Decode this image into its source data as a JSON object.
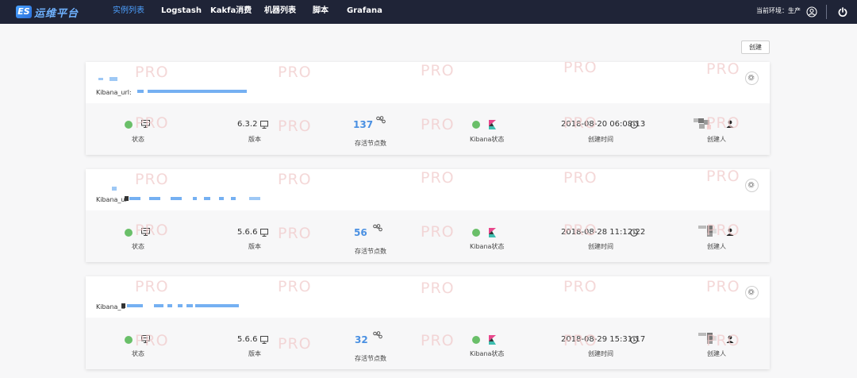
{
  "header": {
    "logo_es": "ES",
    "logo_text": "运维平台",
    "nav": [
      "实例列表",
      "Logstash",
      "Kakfa消费",
      "机器列表",
      "脚本",
      "Grafana"
    ],
    "env_label": "当前环境：生产"
  },
  "toolbar": {
    "create_label": "创建"
  },
  "watermark": "PRO",
  "labels": {
    "status": "状态",
    "version": "版本",
    "alive_nodes": "存活节点数",
    "kibana_status": "Kibana状态",
    "created_time": "创建时间",
    "creator": "创建人"
  },
  "instances": [
    {
      "kibana_prefix": "Kibana_url:",
      "version": "6.3.2",
      "alive_nodes": "137",
      "created_time": "2018-08-20 06:08:13"
    },
    {
      "kibana_prefix": "Kibana_ur",
      "version": "5.6.6",
      "alive_nodes": "56",
      "created_time": "2018-08-28 11:12:22"
    },
    {
      "kibana_prefix": "Kibana_u",
      "version": "5.6.6",
      "alive_nodes": "32",
      "created_time": "2018-08-29 15:31:17"
    }
  ],
  "colors": {
    "topbar": "#1f2437",
    "accent": "#4da0ff",
    "ok": "#6abf69",
    "kibana_pink": "#e8478b",
    "kibana_teal": "#3ebeb0"
  }
}
